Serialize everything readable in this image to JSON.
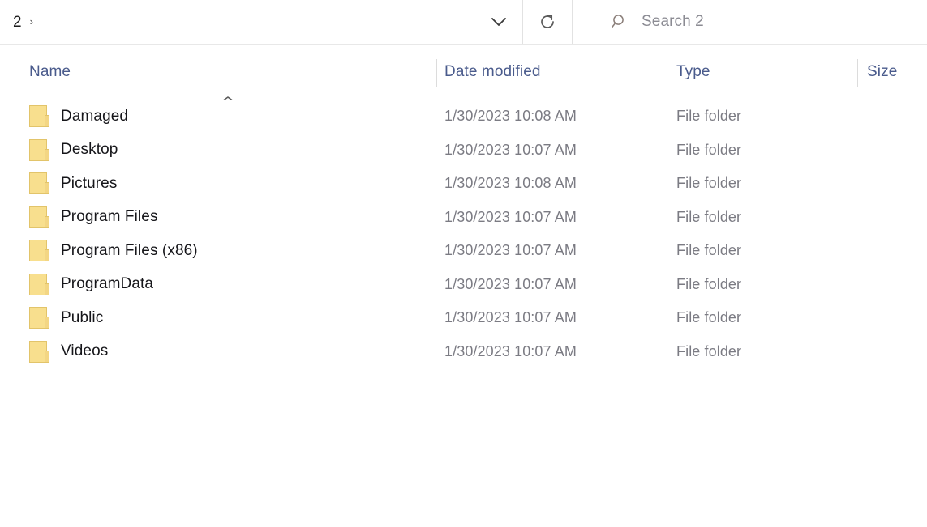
{
  "window": {
    "type": "file-explorer"
  },
  "address_bar": {
    "breadcrumb_label": "2",
    "breadcrumb_chevron": "›",
    "dropdown_icon": "chevron-down-icon",
    "refresh_icon": "refresh-icon",
    "search": {
      "placeholder": "Search 2",
      "value": "",
      "icon": "search-icon"
    }
  },
  "columns": {
    "name": "Name",
    "date_modified": "Date modified",
    "type": "Type",
    "size": "Size",
    "sort": {
      "column": "Name",
      "direction": "ascending",
      "indicator": "⌃"
    }
  },
  "files": [
    {
      "name": "Damaged",
      "date_modified": "1/30/2023 10:08 AM",
      "type": "File folder",
      "size": "",
      "icon": "folder-icon"
    },
    {
      "name": "Desktop",
      "date_modified": "1/30/2023 10:07 AM",
      "type": "File folder",
      "size": "",
      "icon": "folder-icon"
    },
    {
      "name": "Pictures",
      "date_modified": "1/30/2023 10:08 AM",
      "type": "File folder",
      "size": "",
      "icon": "folder-icon"
    },
    {
      "name": "Program Files",
      "date_modified": "1/30/2023 10:07 AM",
      "type": "File folder",
      "size": "",
      "icon": "folder-icon"
    },
    {
      "name": "Program Files (x86)",
      "date_modified": "1/30/2023 10:07 AM",
      "type": "File folder",
      "size": "",
      "icon": "folder-icon"
    },
    {
      "name": "ProgramData",
      "date_modified": "1/30/2023 10:07 AM",
      "type": "File folder",
      "size": "",
      "icon": "folder-icon"
    },
    {
      "name": "Public",
      "date_modified": "1/30/2023 10:07 AM",
      "type": "File folder",
      "size": "",
      "icon": "folder-icon"
    },
    {
      "name": "Videos",
      "date_modified": "1/30/2023 10:07 AM",
      "type": "File folder",
      "size": "",
      "icon": "folder-icon"
    }
  ],
  "colors": {
    "header_text": "#4a5b8c",
    "name_text": "#16161a",
    "meta_text": "#7b7b83",
    "folder_fill": "#f8df8e",
    "folder_border": "#e2c46a",
    "background": "#ffffff",
    "divider": "#dcdcdc"
  }
}
